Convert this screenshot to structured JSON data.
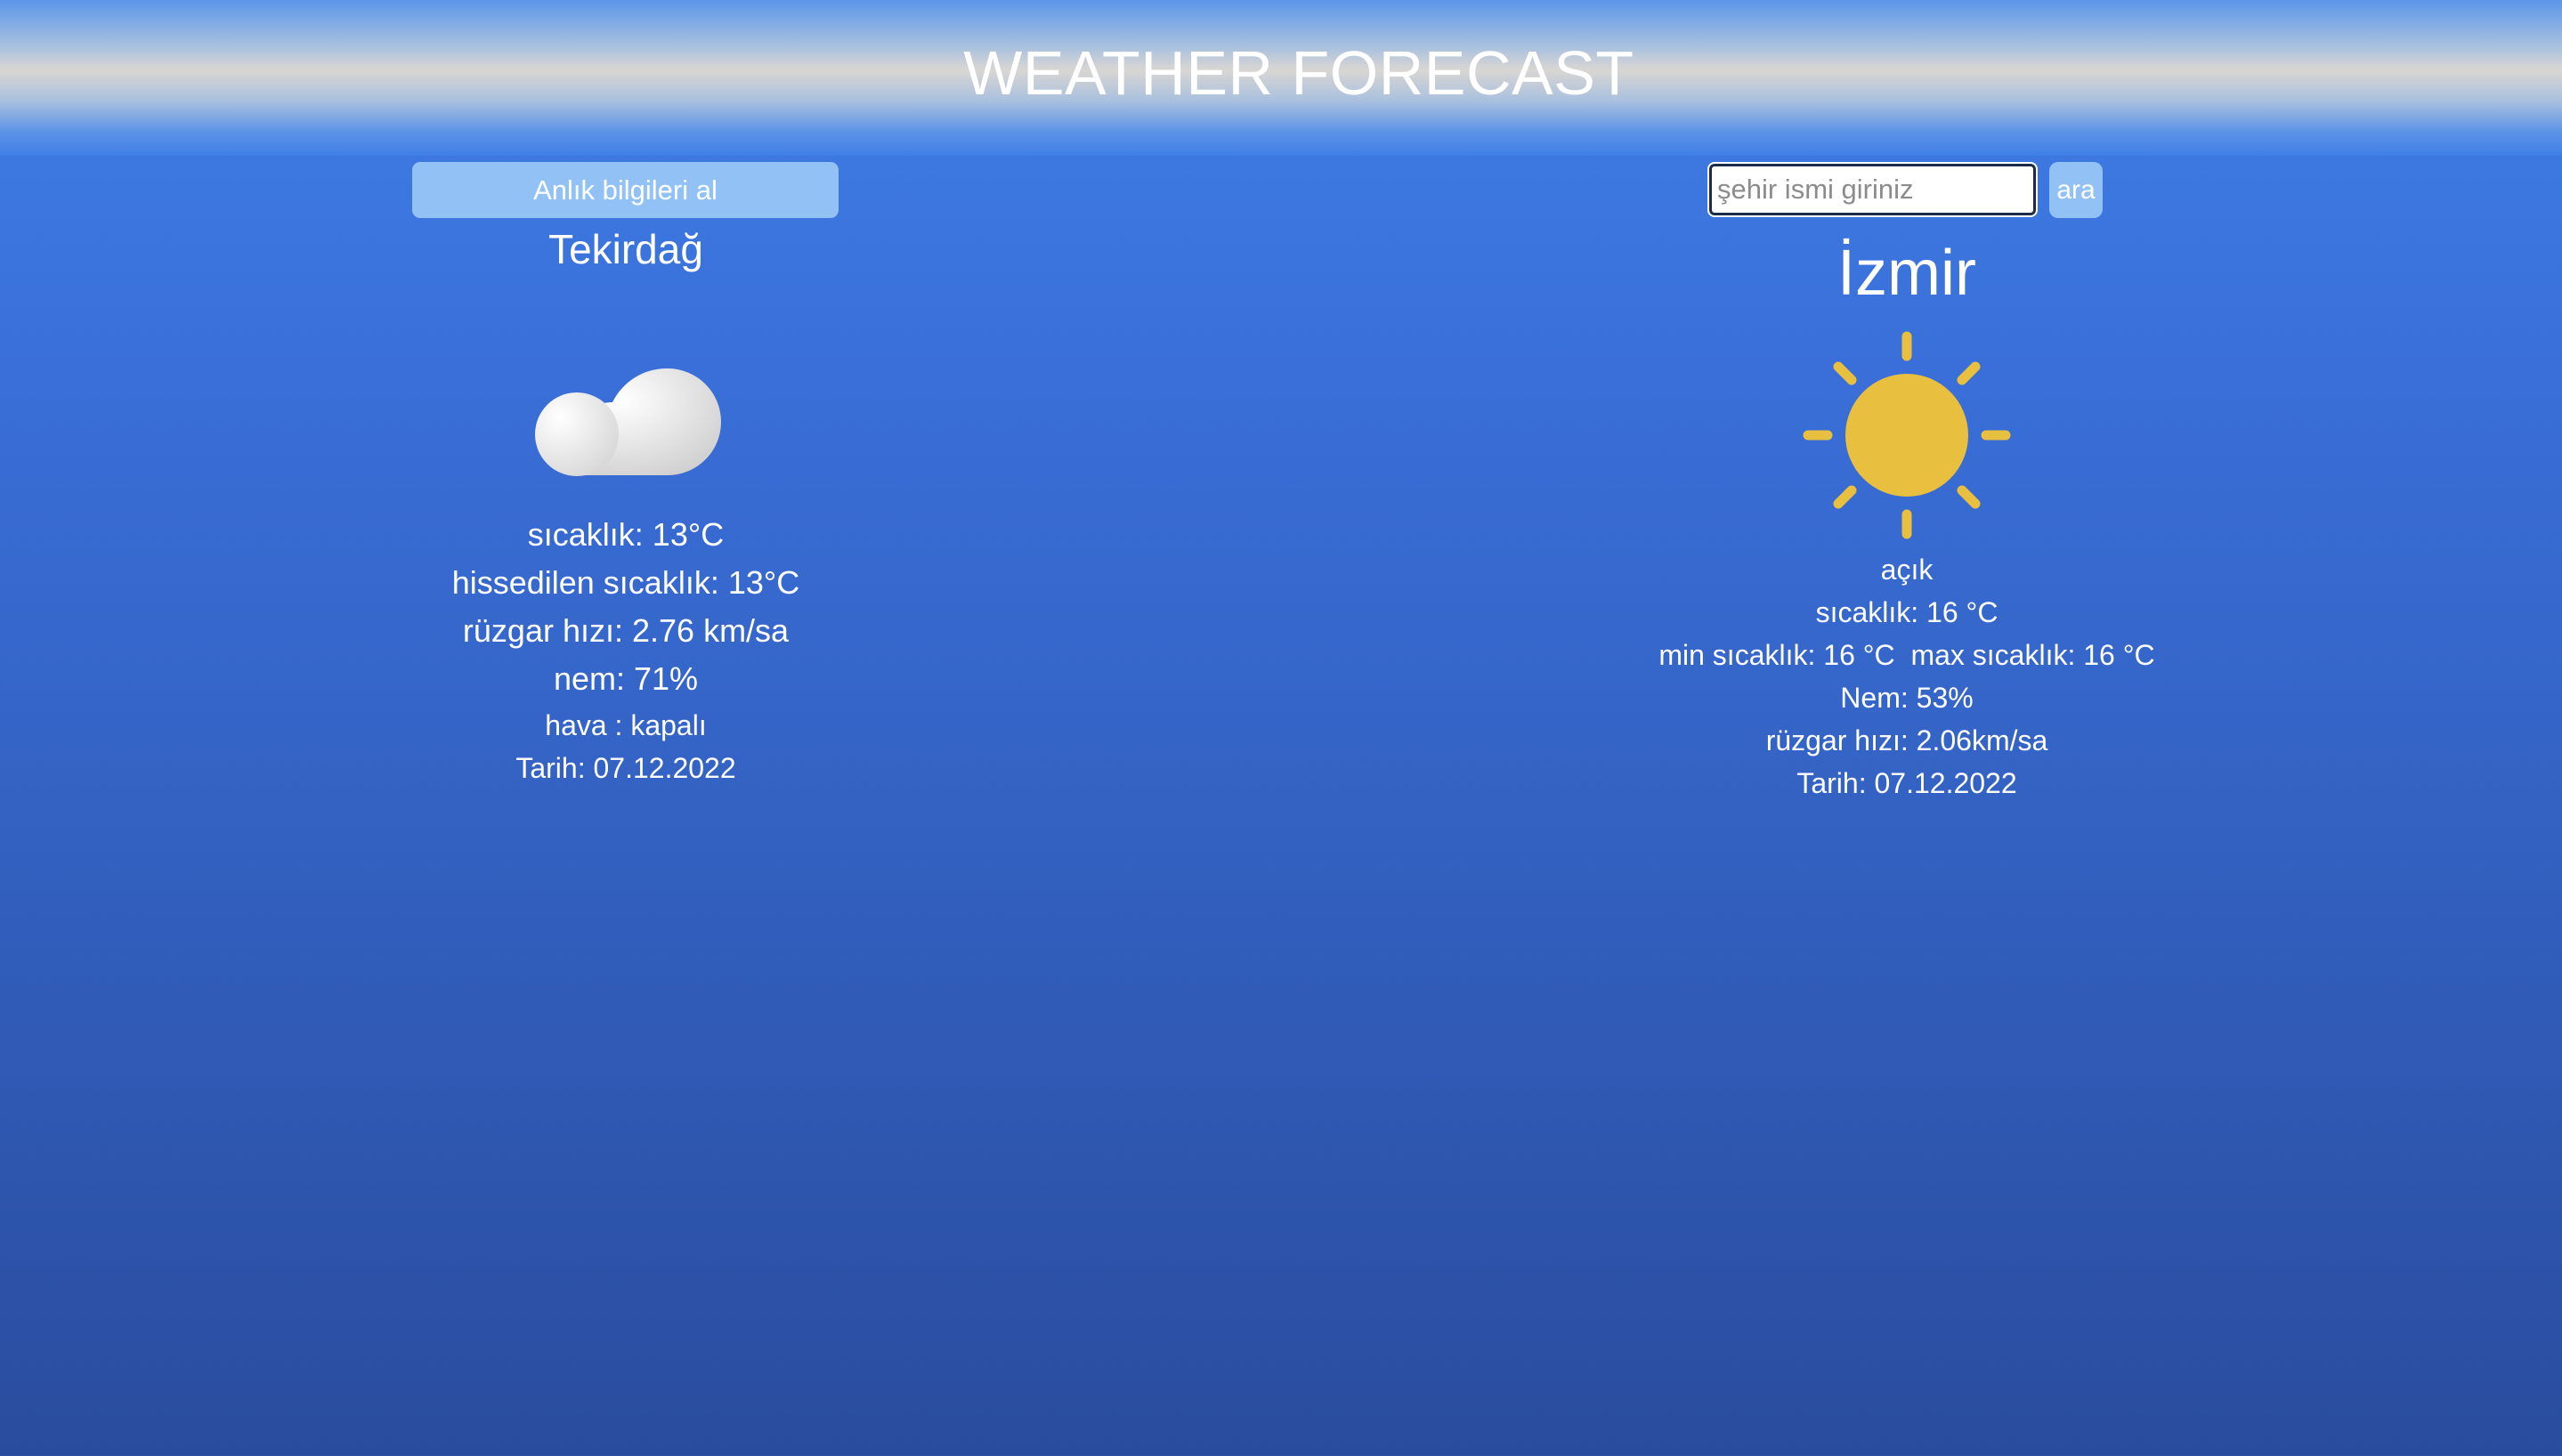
{
  "header": {
    "title": "WEATHER FORECAST"
  },
  "left_panel": {
    "button_label": "Anlık bilgileri al",
    "city": "Tekirdağ",
    "icon": "cloud-icon",
    "temperature": "sıcaklık: 13°C",
    "feels_like": "hissedilen sıcaklık: 13°C",
    "wind": "rüzgar hızı: 2.76 km/sa",
    "humidity": "nem: 71%",
    "weather": "hava : kapalı",
    "date": "Tarih: 07.12.2022"
  },
  "right_panel": {
    "search_placeholder": "şehir ismi giriniz",
    "search_value": "",
    "search_button_label": "ara",
    "city": "İzmir",
    "icon": "sun-icon",
    "condition": "açık",
    "temperature": "sıcaklık: 16 °C",
    "min_max": "min sıcaklık: 16 °C  max sıcaklık: 16 °C",
    "humidity": "Nem: 53%",
    "wind": "rüzgar hızı: 2.06km/sa",
    "date": "Tarih: 07.12.2022"
  },
  "colors": {
    "background_top": "#3f7fe6",
    "background_bottom": "#2a4c9e",
    "button": "#92c2f5",
    "sun": "#e8bf3e",
    "text": "#ffffff"
  }
}
